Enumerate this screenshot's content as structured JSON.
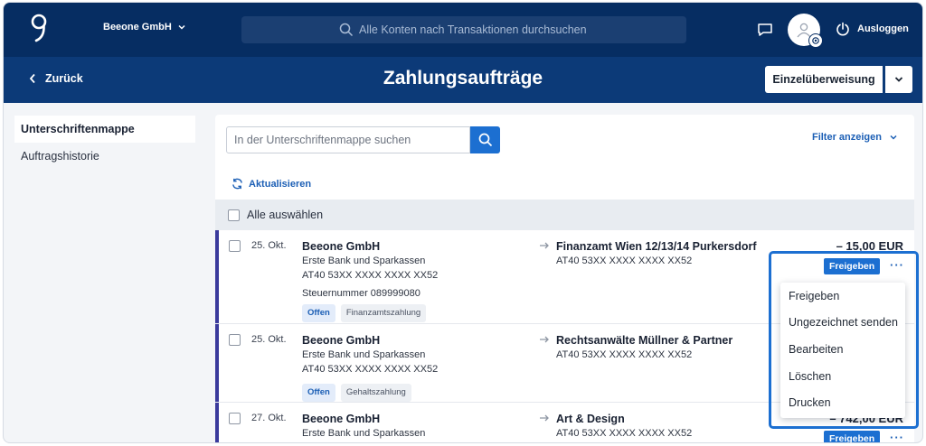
{
  "topbar": {
    "company": "Beeone GmbH",
    "search_placeholder": "Alle Konten nach Transaktionen durchsuchen",
    "logout": "Ausloggen"
  },
  "header": {
    "back": "Zurück",
    "title": "Zahlungsaufträge",
    "primary_action": "Einzelüberweisung"
  },
  "sidenav": {
    "items": [
      {
        "label": "Unterschriftenmappe"
      },
      {
        "label": "Auftragshistorie"
      }
    ]
  },
  "toolbar": {
    "search_placeholder": "In der Unterschriftenmappe suchen",
    "filter": "Filter anzeigen",
    "refresh": "Aktualisieren",
    "select_all": "Alle auswählen"
  },
  "rows": [
    {
      "date": "25. Okt.",
      "from_name": "Beeone GmbH",
      "from_bank": "Erste Bank und Sparkassen",
      "from_iban": "AT40 53XX XXXX XXXX XX52",
      "from_extra": "Steuernummer 089999080",
      "to_name": "Finanzamt Wien 12/13/14 Purkersdorf",
      "to_iban": "AT40 53XX XXXX XXXX XX52",
      "amount": "– 15,00 EUR",
      "tag_status": "Offen",
      "tag_type": "Finanzamtszahlung"
    },
    {
      "date": "25. Okt.",
      "from_name": "Beeone GmbH",
      "from_bank": "Erste Bank und Sparkassen",
      "from_iban": "AT40 53XX XXXX XXXX XX52",
      "to_name": "Rechtsanwälte Müllner & Partner",
      "to_iban": "AT40 53XX XXXX XXXX XX52",
      "tag_status": "Offen",
      "tag_type": "Gehaltszahlung"
    },
    {
      "date": "27. Okt.",
      "from_name": "Beeone GmbH",
      "from_bank": "Erste Bank und Sparkassen",
      "to_name": "Art & Design",
      "to_iban": "AT40 53XX XXXX XXXX XX52",
      "amount": "– 742,00 EUR"
    }
  ],
  "row_actions": {
    "release": "Freigeben",
    "more": "···"
  },
  "menu": {
    "items": [
      {
        "label": "Freigeben"
      },
      {
        "label": "Ungezeichnet senden"
      },
      {
        "label": "Bearbeiten"
      },
      {
        "label": "Löschen"
      },
      {
        "label": "Drucken"
      }
    ]
  },
  "colors": {
    "topbar": "#062d62",
    "header_band": "#0c3a78",
    "accent": "#1c6fd1",
    "row_marker": "#3a3a9c"
  }
}
